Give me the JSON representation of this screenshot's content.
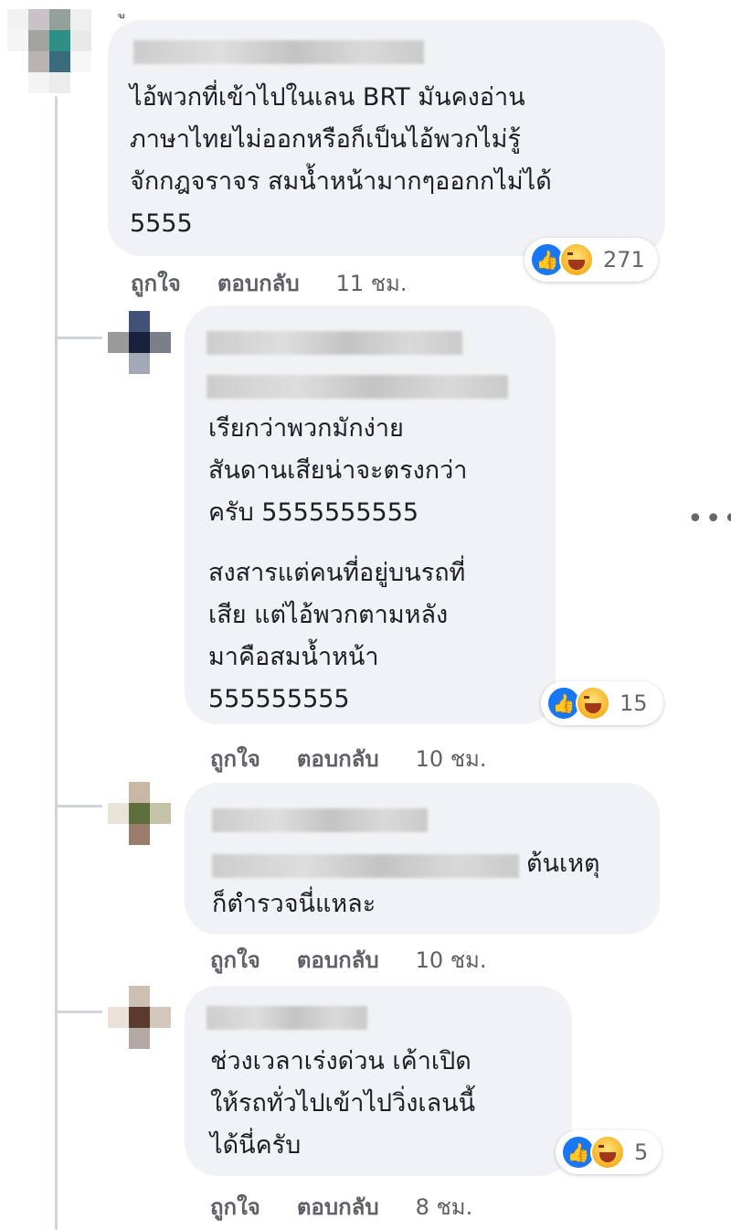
{
  "comments": [
    {
      "text": "ไอ้พวกที่เข้าไปในเลน BRT มันคงอ่าน\nภาษาไทยไม่ออกหรือก็เป็นไอ้พวกไม่รู้\nจักกฎจราจร สมน้ำหน้ามากๆออกกไม่ได้\n5555",
      "like_label": "ถูกใจ",
      "reply_label": "ตอบกลับ",
      "time": "11 ชม.",
      "reaction_count": "271"
    },
    {
      "text": "เรียกว่าพวกมักง่าย\nสันดานเสียน่าจะตรงกว่า\nครับ 5555555555",
      "text2": "สงสารแต่คนที่อยู่บนรถที่\nเสีย แต่ไอ้พวกตามหลัง\nมาคือสมน้ำหน้า\n555555555",
      "like_label": "ถูกใจ",
      "reply_label": "ตอบกลับ",
      "time": "10 ชม.",
      "reaction_count": "15"
    },
    {
      "text_tail": "ต้นเหตุ",
      "text2": "ก็ตำรวจนี่แหละ",
      "like_label": "ถูกใจ",
      "reply_label": "ตอบกลับ",
      "time": "10 ชม."
    },
    {
      "text": "ช่วงเวลาเร่งด่วน เค้าเปิด\nให้รถทั่วไปเข้าไปวิ่งเลนนี้\nได้นี่ครับ",
      "like_label": "ถูกใจ",
      "reply_label": "ตอบกลับ",
      "time": "8 ชม.",
      "reaction_count": "5"
    }
  ],
  "more_icon": "more-horizontal-icon",
  "colors": {
    "bubble": "#f0f2f5",
    "like_blue": "#1877f2",
    "meta_text": "#65676b"
  }
}
